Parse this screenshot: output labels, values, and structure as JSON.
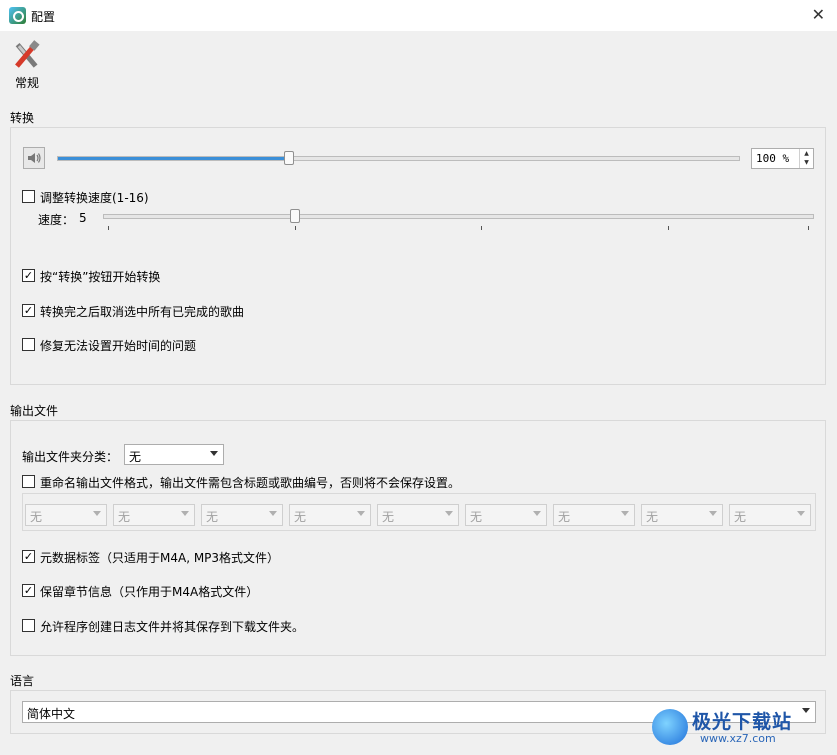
{
  "window": {
    "title": "配置",
    "close_glyph": "✕"
  },
  "toolbar": {
    "general_label": "常规"
  },
  "conversion": {
    "section_label": "转换",
    "volume_value": "100 %",
    "volume_level_fraction": 0.34,
    "adjust_speed_label": "调整转换速度(1-16)",
    "adjust_speed_checked": false,
    "speed_label": "速度：",
    "speed_value": "5",
    "start_on_convert_label": "按“转换”按钮开始转换",
    "start_on_convert_checked": true,
    "deselect_after_label": "转换完之后取消选中所有已完成的歌曲",
    "deselect_after_checked": true,
    "fix_start_time_label": "修复无法设置开始时间的问题",
    "fix_start_time_checked": false
  },
  "output": {
    "section_label": "输出文件",
    "folder_category_label": "输出文件夹分类：",
    "folder_category_value": "无",
    "rename_label": "重命名输出文件格式，输出文件需包含标题或歌曲编号，否则将不会保存设置。",
    "rename_checked": false,
    "rename_parts": [
      "无",
      "无",
      "无",
      "无",
      "无",
      "无",
      "无",
      "无",
      "无"
    ],
    "metadata_label": "元数据标签（只适用于M4A, MP3格式文件）",
    "metadata_checked": true,
    "chapters_label": "保留章节信息（只作用于M4A格式文件）",
    "chapters_checked": true,
    "log_label": "允许程序创建日志文件并将其保存到下载文件夹。",
    "log_checked": false
  },
  "language": {
    "section_label": "语言",
    "value": "简体中文"
  },
  "watermark": {
    "brand": "极光下载站",
    "url": "www.xz7.com"
  },
  "icons": [
    "app-icon",
    "tools-icon",
    "speaker-icon",
    "close-icon",
    "chevron-down-icon",
    "check-icon"
  ]
}
